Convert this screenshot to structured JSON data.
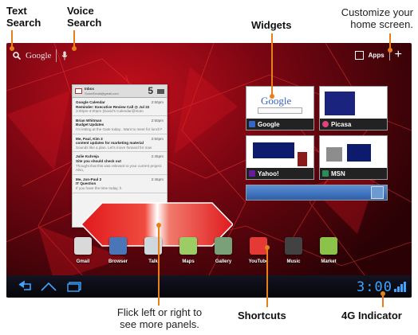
{
  "callouts": {
    "text_search": [
      "Text",
      "Search"
    ],
    "voice_search": [
      "Voice",
      "Search"
    ],
    "widgets": "Widgets",
    "customize": [
      "Customize your",
      "home screen."
    ],
    "flick": [
      "Flick left or right to",
      "see more panels."
    ],
    "shortcuts": "Shortcuts",
    "indicator": "4G Indicator"
  },
  "statusbar": {
    "search_text": "Google",
    "apps_label": "Apps",
    "add_symbol": "+"
  },
  "email_widget": {
    "inbox_label": "Inbox",
    "account": "SomeEmail@gmail.com",
    "count": "5",
    "messages": [
      {
        "from": "Google Calendar",
        "time": "2:50pm",
        "subject": "Reminder: Executive Review Call @ Jul 22",
        "preview": "3:00pm-4:00pm (David's Calendar@moto"
      },
      {
        "from": "Brian Whitman",
        "time": "2:50pm",
        "subject": "Budget Updates",
        "preview": "I'm letting at the Gate today.. Want to meet for lunch?"
      },
      {
        "from": "Me, Paul, Kim  3",
        "time": "2:50pm",
        "subject": "content updates for marketing material",
        "preview": "Sounds like a plan. Let's move forward for now"
      },
      {
        "from": "Julie Kuhreja",
        "time": "2:45pm",
        "subject": "Site you should check out",
        "preview": "Thought that this was relevant to your current project. Also,"
      },
      {
        "from": "Me, Jon-Paul  2",
        "time": "2:45pm",
        "subject": "IT Question",
        "preview": "If you have the time today, h"
      }
    ]
  },
  "widgets": [
    {
      "name": "Google",
      "color": "#3a64c4"
    },
    {
      "name": "Picasa",
      "color": "#e0457a"
    },
    {
      "name": "Yahoo!",
      "color": "#6a1b9a"
    },
    {
      "name": "MSN",
      "color": "#2e8b57"
    }
  ],
  "shortcuts": [
    {
      "name": "Gmail",
      "color": "#d9d9d9"
    },
    {
      "name": "Browser",
      "color": "#4a76b8"
    },
    {
      "name": "Talk",
      "color": "#cfd8dc"
    },
    {
      "name": "Maps",
      "color": "#9ccc65"
    },
    {
      "name": "Gallery",
      "color": "#7aa07a"
    },
    {
      "name": "YouTube",
      "color": "#e53935"
    },
    {
      "name": "Music",
      "color": "#424242"
    },
    {
      "name": "Market",
      "color": "#8bc34a"
    }
  ],
  "navbar": {
    "clock": "3:00",
    "network": "4G"
  },
  "colors": {
    "accent": "#e8801a",
    "clock": "#3fa4ff"
  }
}
